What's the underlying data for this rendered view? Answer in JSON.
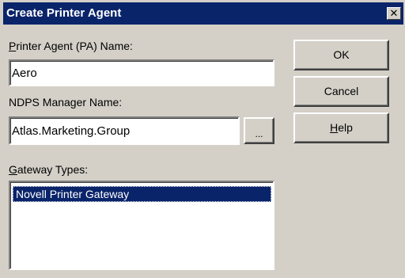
{
  "window": {
    "title": "Create Printer Agent",
    "close_glyph": "✕"
  },
  "pa_name": {
    "label_accel": "P",
    "label_rest": "rinter Agent (PA) Name:",
    "value": "Aero"
  },
  "manager": {
    "label": "NDPS Manager Name:",
    "value": "Atlas.Marketing.Group",
    "browse_label": "..."
  },
  "gateway": {
    "label_accel": "G",
    "label_rest": "ateway Types:",
    "items": [
      "Novell Printer Gateway"
    ],
    "selected_index": 0
  },
  "buttons": {
    "ok": "OK",
    "cancel": "Cancel",
    "help_accel": "H",
    "help_rest": "elp"
  },
  "colors": {
    "title_bar": "#0a246a",
    "face": "#d4d0c8",
    "selection": "#0a246a"
  }
}
